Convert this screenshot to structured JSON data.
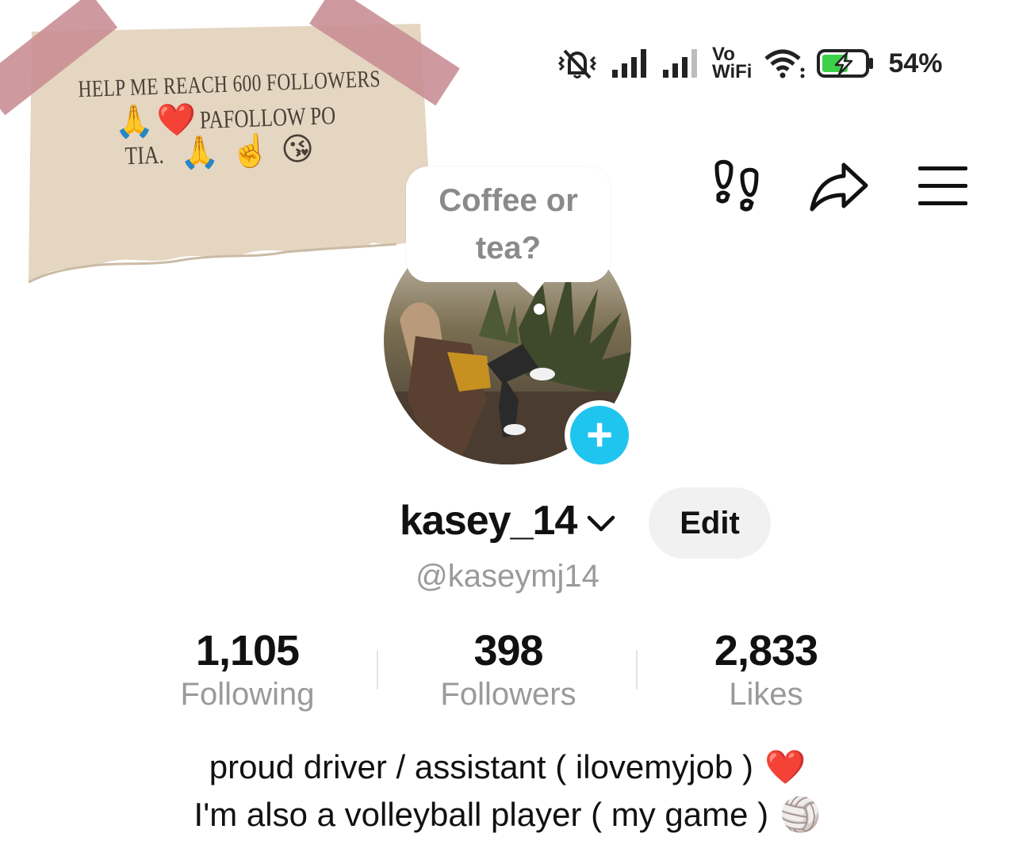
{
  "status_bar": {
    "battery_percent": "54%",
    "vowifi_top": "Vo",
    "vowifi_bottom": "WiFi",
    "icons": [
      "mute-vibrate-icon",
      "signal-icon",
      "signal-icon",
      "vowifi-icon",
      "wifi-icon",
      "battery-charging-icon"
    ]
  },
  "note": {
    "line1": "Help me reach 600 followers",
    "line2_text": "Pafollow po",
    "line3_text": "TIA.",
    "emojis": {
      "pray": "🙏",
      "heart": "❤️",
      "point_up": "☝️",
      "kiss": "😘"
    }
  },
  "toolbar": {
    "icons": [
      "footprints-icon",
      "share-icon",
      "menu-icon"
    ]
  },
  "bubble": {
    "text_line1": "Coffee or",
    "text_line2": "tea?"
  },
  "profile": {
    "username": "kasey_14",
    "handle": "@kaseymj14",
    "edit_label": "Edit",
    "add_symbol": "+"
  },
  "stats": [
    {
      "value": "1,105",
      "label": "Following"
    },
    {
      "value": "398",
      "label": "Followers"
    },
    {
      "value": "2,833",
      "label": "Likes"
    }
  ],
  "bio": {
    "line1": "proud driver / assistant ( ilovemyjob )",
    "line1_emoji": "❤️",
    "line2": "I'm also a volleyball player ( my game )",
    "line2_emoji": "🏐"
  },
  "colors": {
    "accent": "#20c5ef",
    "battery_green": "#3dd14a",
    "tape": "#c98f95",
    "paper": "#e4d6c1"
  }
}
